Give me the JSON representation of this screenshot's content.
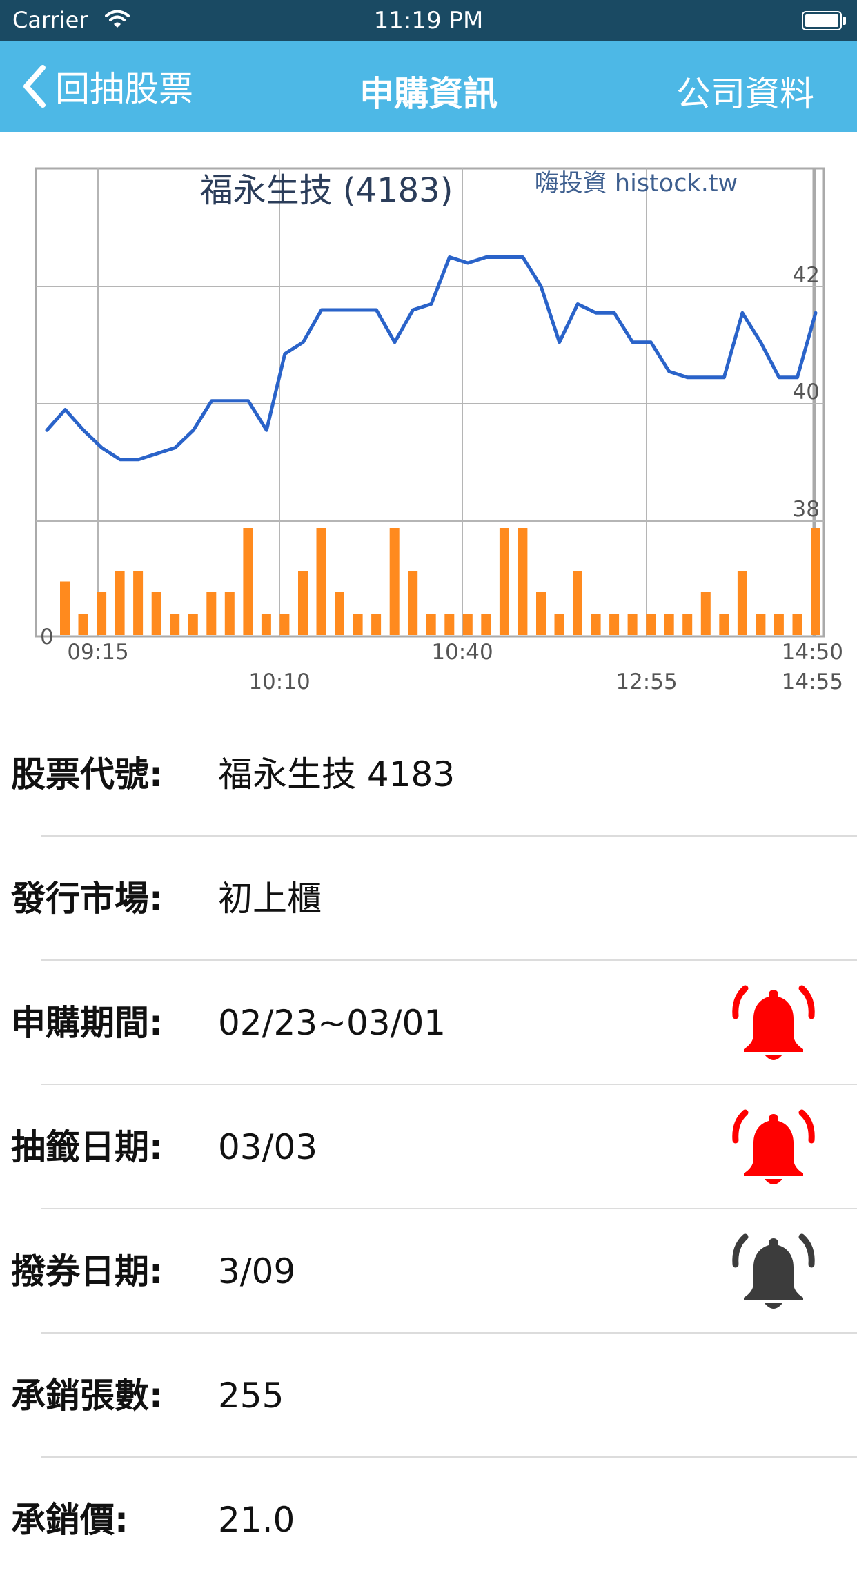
{
  "status_bar": {
    "carrier": "Carrier",
    "time": "11:19 PM"
  },
  "nav": {
    "back_label": "回抽股票",
    "title": "申購資訊",
    "right_label": "公司資料"
  },
  "chart_data": {
    "type": "line",
    "title": "福永生技 (4183)",
    "watermark": "嗨投資 histock.tw",
    "price_ticks": [
      "42",
      "40",
      "38"
    ],
    "volume_zero_label": "0",
    "time_labels_top": [
      "09:15",
      "10:40",
      "14:50"
    ],
    "time_labels_bottom": [
      "10:10",
      "12:55",
      "14:55"
    ],
    "line_color": "#2a63c9",
    "bar_color": "#ff8a1e",
    "ylim": [
      36,
      44
    ],
    "price_series": [
      39.55,
      39.9,
      39.55,
      39.25,
      39.05,
      39.05,
      39.15,
      39.25,
      39.55,
      40.05,
      40.05,
      40.05,
      39.55,
      40.85,
      41.05,
      41.6,
      41.6,
      41.6,
      41.6,
      41.05,
      41.6,
      41.7,
      42.5,
      42.4,
      42.5,
      42.5,
      42.5,
      42.0,
      41.05,
      41.7,
      41.55,
      41.55,
      41.05,
      41.05,
      40.55,
      40.45,
      40.45,
      40.45,
      41.55,
      41.05,
      40.45,
      40.45,
      41.55
    ],
    "volume_series": [
      5,
      2,
      4,
      6,
      6,
      4,
      2,
      2,
      4,
      4,
      10,
      2,
      2,
      6,
      10,
      4,
      2,
      2,
      10,
      6,
      2,
      2,
      2,
      2,
      10,
      10,
      4,
      2,
      6,
      2,
      2,
      2,
      2,
      2,
      2,
      4,
      2,
      6,
      2,
      2,
      2,
      10
    ],
    "volume_scale_max": 10
  },
  "info_rows": [
    {
      "label": "股票代號:",
      "value": "福永生技 4183",
      "bell": false
    },
    {
      "label": "發行市場:",
      "value": "初上櫃",
      "bell": false
    },
    {
      "label": "申購期間:",
      "value": "02/23~03/01",
      "bell": true,
      "bell_color": "#ff0000"
    },
    {
      "label": "抽籤日期:",
      "value": "03/03",
      "bell": true,
      "bell_color": "#ff0000"
    },
    {
      "label": "撥券日期:",
      "value": "3/09",
      "bell": true,
      "bell_color": "#3c3c3c"
    },
    {
      "label": "承銷張數:",
      "value": "255",
      "bell": false
    },
    {
      "label": "承銷價:",
      "value": "21.0",
      "bell": false
    }
  ]
}
